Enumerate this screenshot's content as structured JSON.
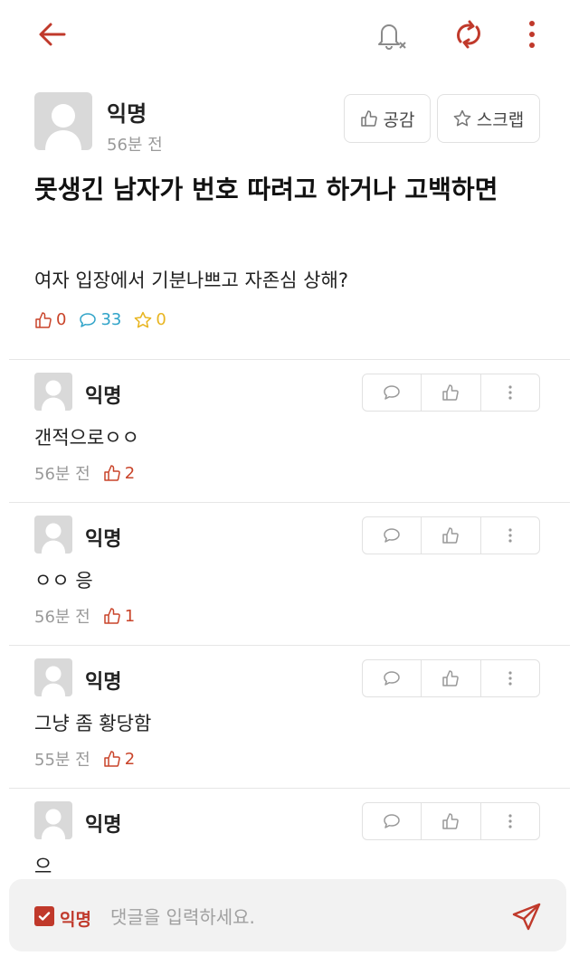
{
  "colors": {
    "accent": "#c0392b",
    "comment_stat": "#2fa3c8",
    "scrap_stat": "#e8b521",
    "muted": "#9a9a9a"
  },
  "toolbar": {
    "back_icon": "arrow-left-icon",
    "bell_icon": "bell-off-icon",
    "refresh_icon": "refresh-icon",
    "more_icon": "vertical-dots-icon"
  },
  "post": {
    "author": "익명",
    "time": "56분 전",
    "like_button": "공감",
    "scrap_button": "스크랩",
    "title": "못생긴 남자가 번호 따려고 하거나 고백하면",
    "body": "여자 입장에서 기분나쁘고 자존심 상해?",
    "stats": {
      "likes": "0",
      "comments": "33",
      "scraps": "0"
    }
  },
  "comments": [
    {
      "author": "익명",
      "text": "갠적으로ㅇㅇ",
      "time": "56분 전",
      "likes": "2"
    },
    {
      "author": "익명",
      "text": "ㅇㅇ 응",
      "time": "56분 전",
      "likes": "1"
    },
    {
      "author": "익명",
      "text": "그냥 좀 황당함",
      "time": "55분 전",
      "likes": "2"
    },
    {
      "author": "익명",
      "text": "으",
      "time": "",
      "likes": ""
    }
  ],
  "input": {
    "anon_label": "익명",
    "placeholder": "댓글을 입력하세요."
  }
}
